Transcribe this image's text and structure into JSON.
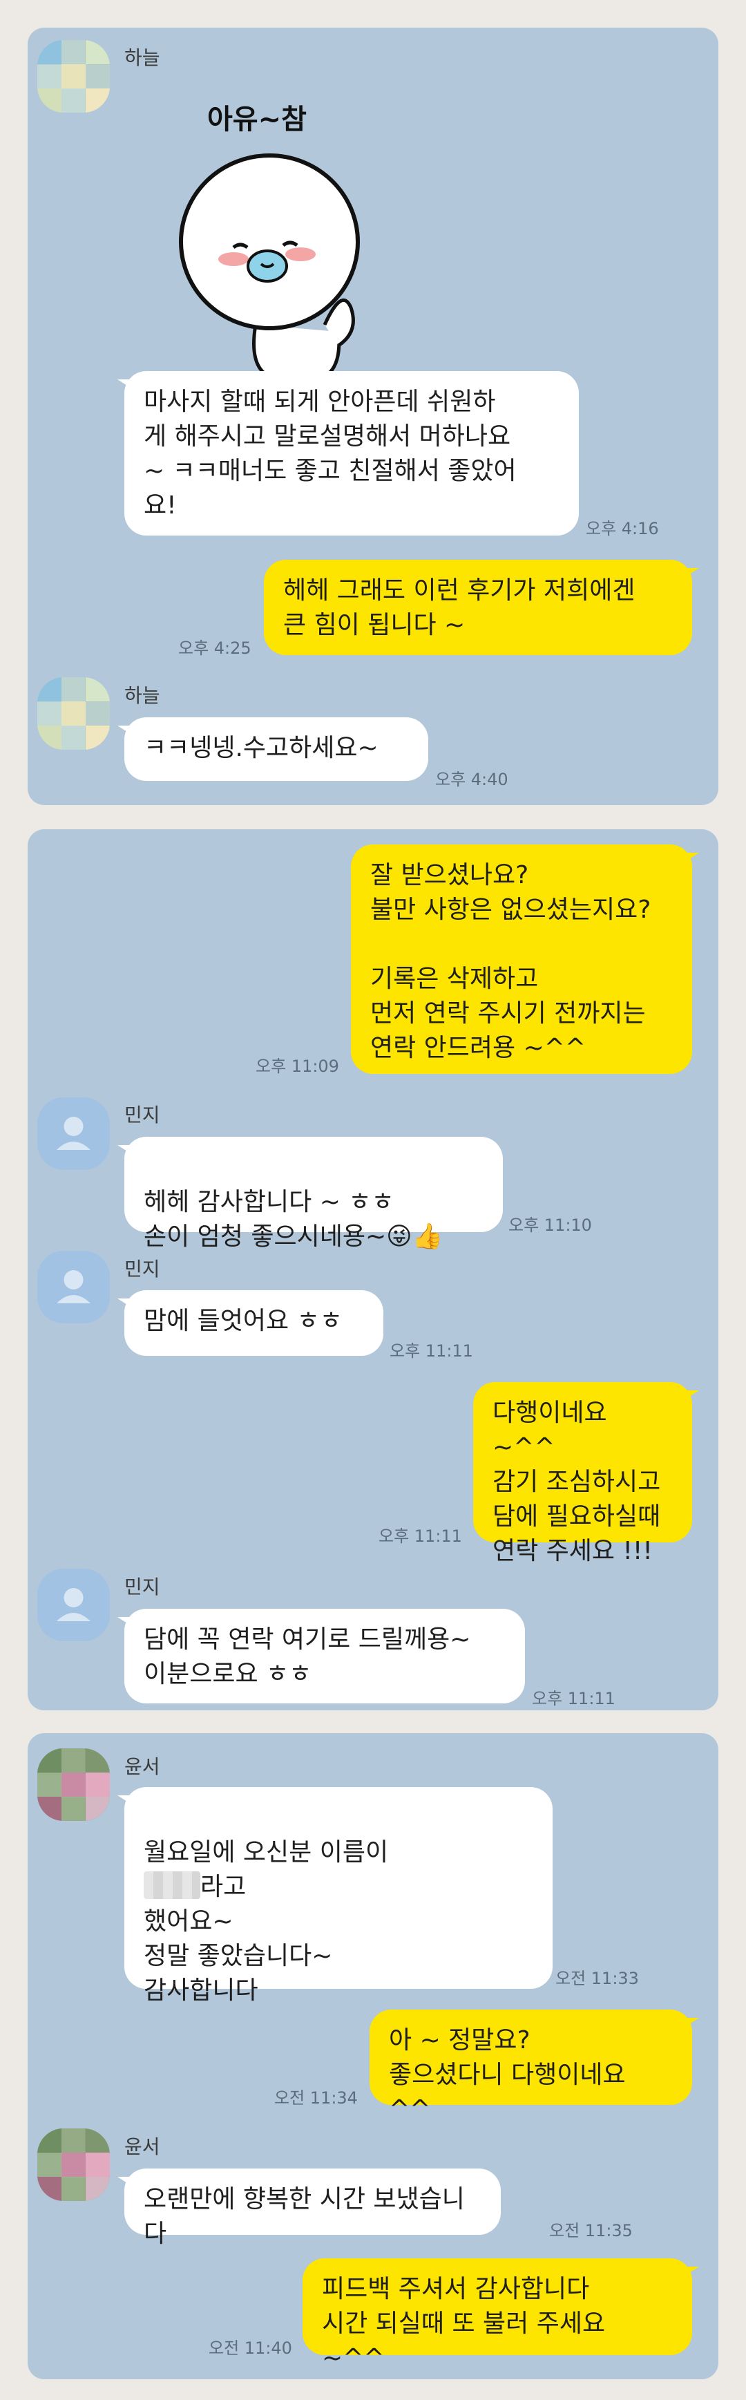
{
  "panel1": {
    "sender1": "하늘",
    "sticker_text": "아유~참",
    "msg1": "마사지 할때 되게 안아픈데 쉬원하\n게 해주시고 말로설명해서 머하나요\n~ ㅋㅋ매너도 좋고 친절해서 좋았어\n요!",
    "time1": "오후 4:16",
    "reply1": "헤헤 그래도 이런 후기가 저희에겐\n큰 힘이 됩니다 ~",
    "reply1_time": "오후 4:25",
    "sender2": "하늘",
    "msg2": "ㅋㅋ넹넹.수고하세요~",
    "time2": "오후 4:40"
  },
  "panel2": {
    "reply1": "잘 받으셨나요?\n불만 사항은 없으셨는지요?\n\n기록은 삭제하고\n먼저 연락 주시기 전까지는\n연락 안드려용 ~^^",
    "reply1_time": "오후 11:09",
    "sender1": "민지",
    "msg1": "헤헤 감사합니다 ~ ㅎㅎ\n손이 엄청 좋으시네용~",
    "msg1_emoji": "😜👍",
    "time1": "오후 11:10",
    "sender2": "민지",
    "msg2": "맘에 들엇어요 ㅎㅎ",
    "time2": "오후 11:11",
    "reply2": "다행이네요 ~^^\n감기 조심하시고\n담에 필요하실때\n연락 주세요 !!!",
    "reply2_time": "오후 11:11",
    "sender3": "민지",
    "msg3": "담에 꼭 연락 여기로 드릴께용~\n이분으로요 ㅎㅎ",
    "time3": "오후 11:11"
  },
  "panel3": {
    "sender1": "윤서",
    "msg1_pre": "월요일에 오신분 이름이",
    "msg1_post": "라고",
    "msg1_rest": "했어요~\n정말 좋았습니다~\n감사합니다",
    "time1": "오전 11:33",
    "reply1": "아 ~ 정말요?\n좋으셨다니 다행이네요 ^^",
    "reply1_time": "오전 11:34",
    "sender2": "윤서",
    "msg2": "오랜만에 향복한 시간 보냈습니다",
    "time2": "오전 11:35",
    "reply2": "피드백 주셔서 감사합니다\n시간 되실때 또 불러 주세요 ~^^",
    "reply2_time": "오전 11:40"
  },
  "colors": {
    "panel_bg": "#b2c7d9",
    "page_bg": "#ede9e5",
    "my_bubble": "#fee500",
    "their_bubble": "#ffffff"
  },
  "icons": [
    "pixelated-avatar",
    "default-person-avatar",
    "sticker-character",
    "winking-face-emoji",
    "thumbs-up-emoji"
  ]
}
